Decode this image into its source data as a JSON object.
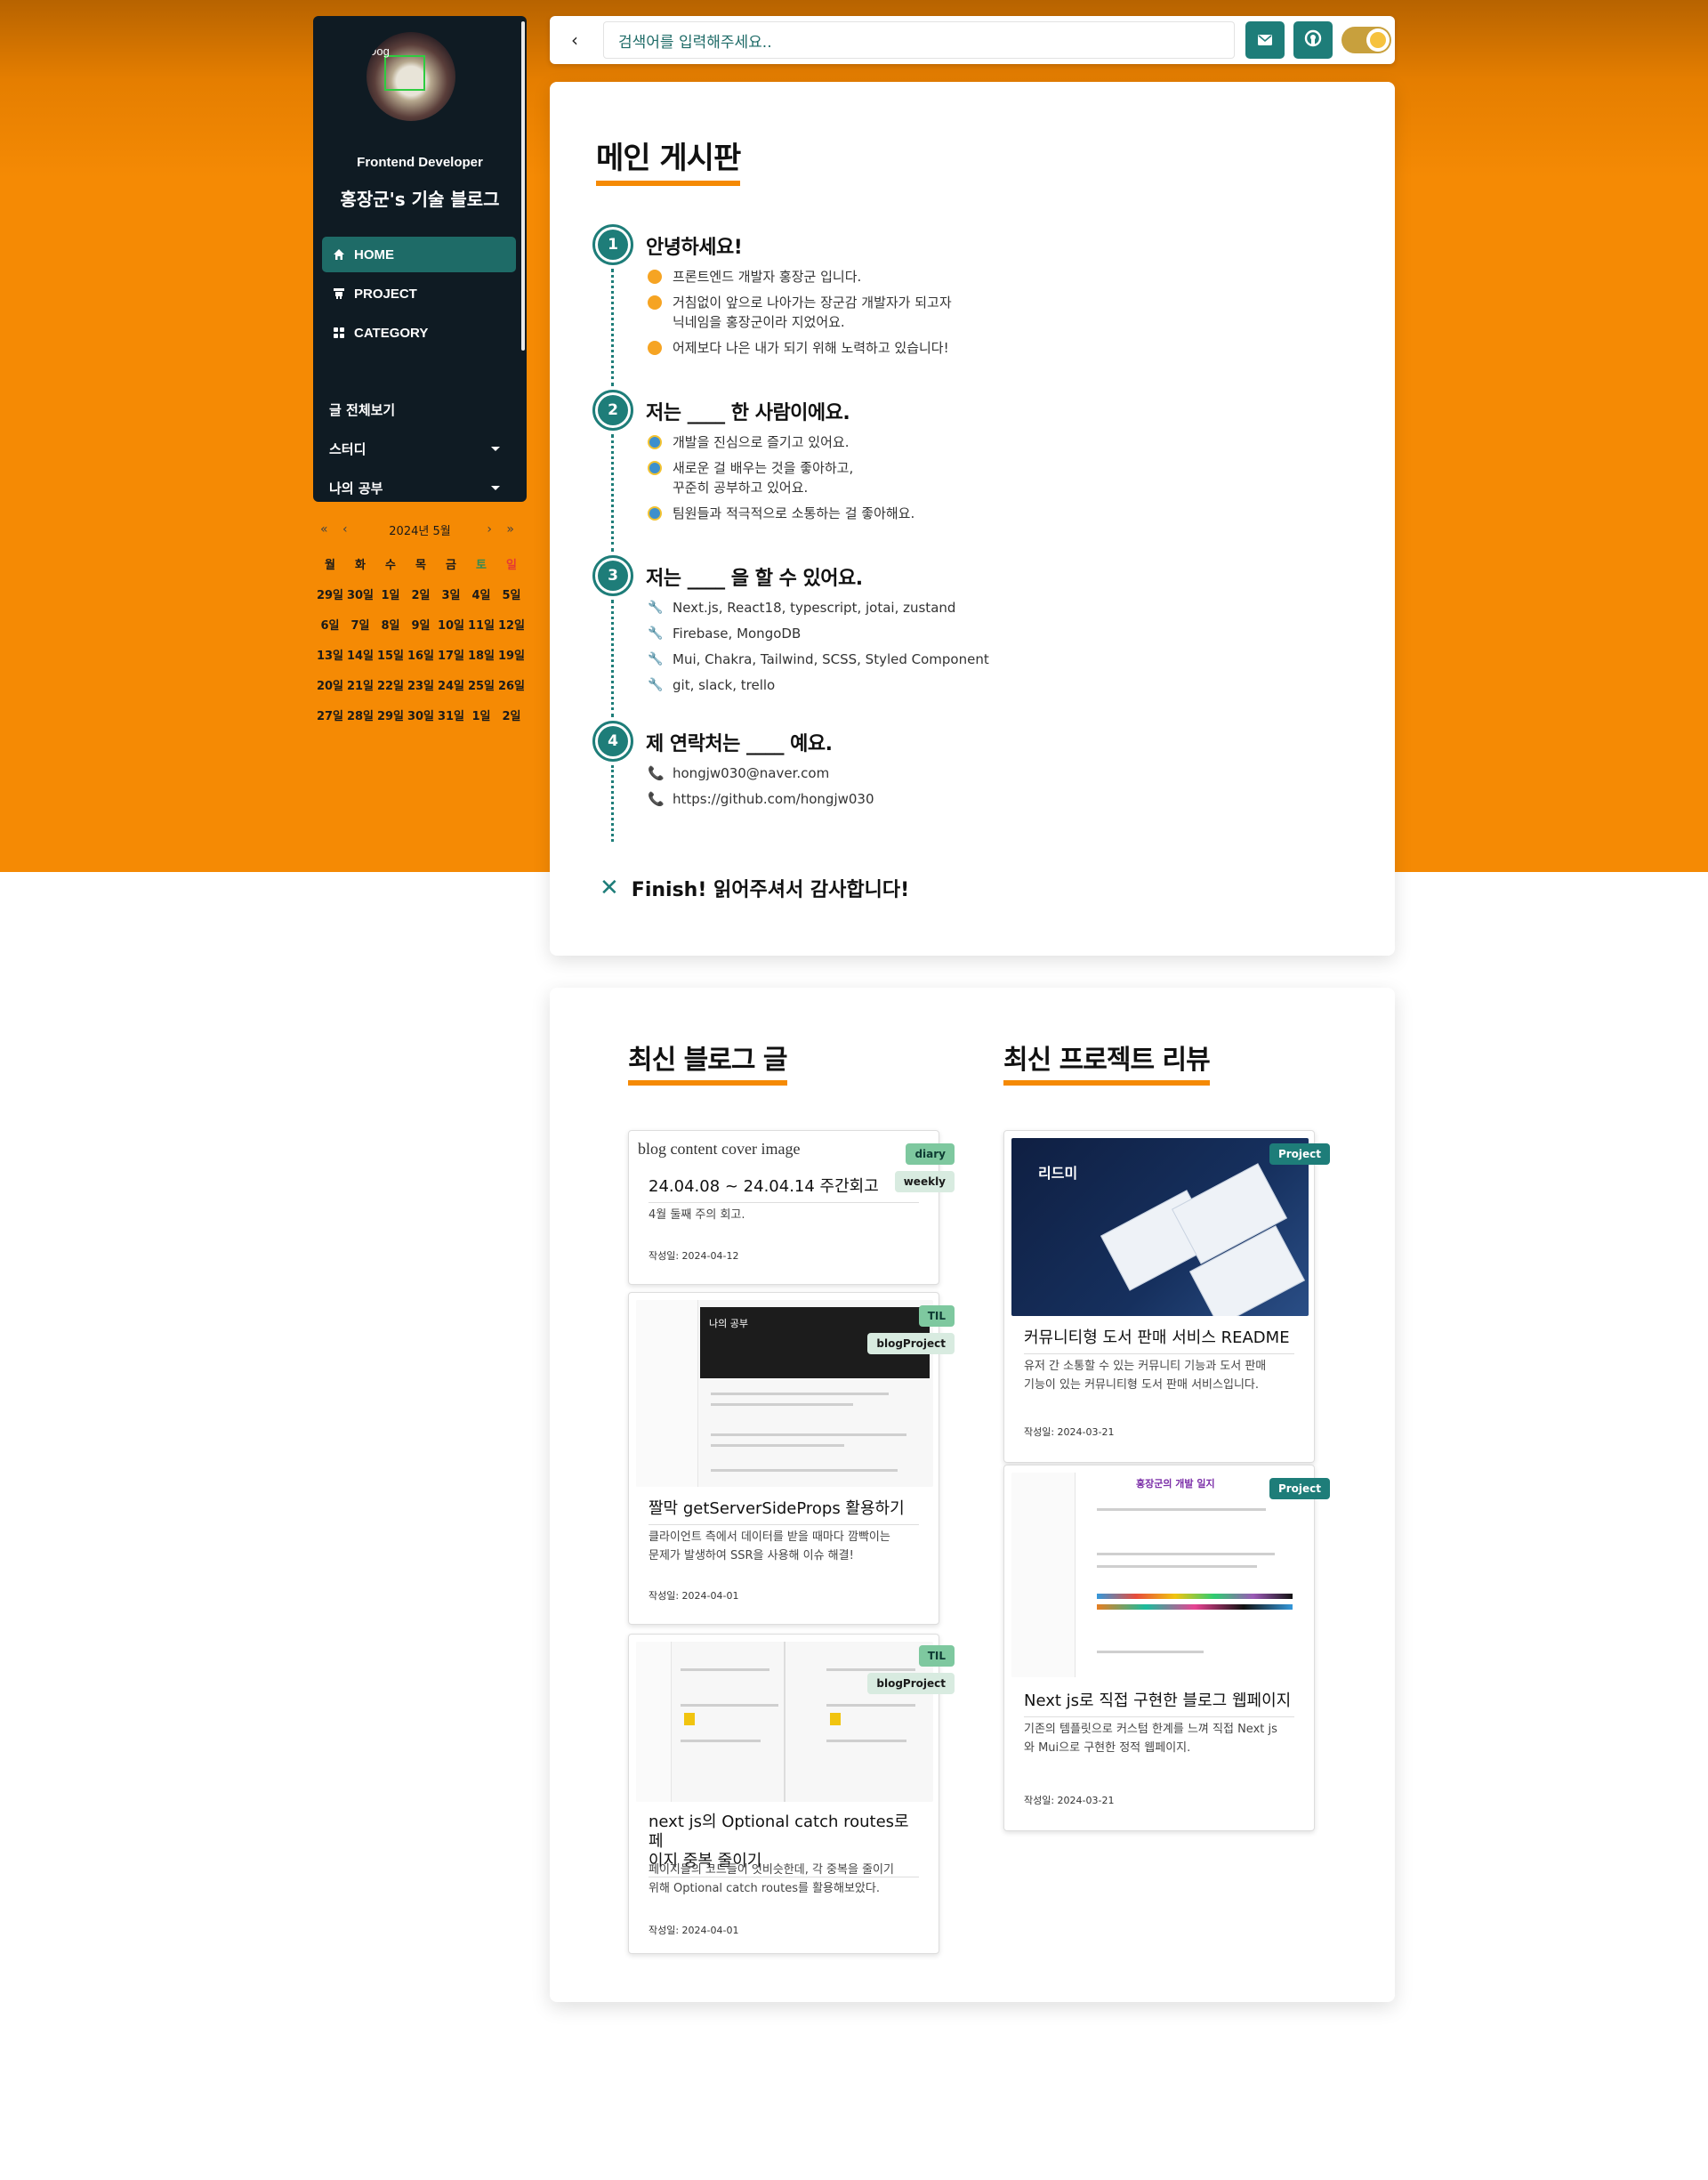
{
  "sidebar": {
    "avatar_label": "Dog",
    "role": "Frontend Developer",
    "title": "홍장군's 기술 블로그",
    "nav": [
      {
        "label": "HOME",
        "icon": "home-icon",
        "active": true
      },
      {
        "label": "PROJECT",
        "icon": "project-icon",
        "active": false
      },
      {
        "label": "CATEGORY",
        "icon": "grid-icon",
        "active": false
      }
    ],
    "categories": [
      {
        "label": "글 전체보기",
        "has_caret": false
      },
      {
        "label": "스터디",
        "has_caret": true
      },
      {
        "label": "나의 공부",
        "has_caret": true
      }
    ]
  },
  "calendar": {
    "prev": "« ‹",
    "month": "2024년 5월",
    "next": "› »",
    "weekdays": [
      "월",
      "화",
      "수",
      "목",
      "금",
      "토",
      "일"
    ],
    "weeks": [
      [
        "29일",
        "30일",
        "1일",
        "2일",
        "3일",
        "4일",
        "5일"
      ],
      [
        "6일",
        "7일",
        "8일",
        "9일",
        "10일",
        "11일",
        "12일"
      ],
      [
        "13일",
        "14일",
        "15일",
        "16일",
        "17일",
        "18일",
        "19일"
      ],
      [
        "20일",
        "21일",
        "22일",
        "23일",
        "24일",
        "25일",
        "26일"
      ],
      [
        "27일",
        "28일",
        "29일",
        "30일",
        "31일",
        "1일",
        "2일"
      ]
    ]
  },
  "topbar": {
    "back": "‹",
    "search_placeholder": "검색어를 입력해주세요..",
    "mail_icon": "mail-icon",
    "github_icon": "github-icon",
    "theme_toggle": "theme-toggle"
  },
  "board": {
    "title": "메인 게시판",
    "steps": [
      {
        "num": "1",
        "title": "안녕하세요!",
        "bullet": "emoji",
        "items": [
          "프론트엔드 개발자 홍장군 입니다.",
          "거침없이 앞으로 나아가는 장군감 개발자가 되고자\n닉네임을 홍장군이라 지었어요.",
          "어제보다 나은 내가 되기 위해 노력하고 있습니다!"
        ]
      },
      {
        "num": "2",
        "title": "저는 ____ 한 사람이에요.",
        "bullet": "shield",
        "items": [
          "개발을 진심으로 즐기고 있어요.",
          "새로운 걸 배우는 것을 좋아하고,\n꾸준히 공부하고 있어요.",
          "팀원들과 적극적으로 소통하는 걸 좋아해요."
        ]
      },
      {
        "num": "3",
        "title": "저는 ____ 을 할 수 있어요.",
        "bullet": "tool",
        "items": [
          "Next.js, React18, typescript, jotai, zustand",
          "Firebase, MongoDB",
          "Mui, Chakra, Tailwind, SCSS, Styled Component",
          "git, slack, trello"
        ]
      },
      {
        "num": "4",
        "title": "제 연락처는 ____ 예요.",
        "bullet": "phone",
        "items": [
          "hongjw030@naver.com",
          "https://github.com/hongjw030"
        ]
      }
    ],
    "finish": "Finish! 읽어주셔서 감사합니다!"
  },
  "latest": {
    "blog_title": "최신 블로그 글",
    "project_title": "최신 프로젝트 리뷰",
    "blog_cards": [
      {
        "image_alt": "blog content cover image",
        "title": "24.04.08 ~ 24.04.14 주간회고",
        "desc": "4월 둘째 주의 회고.",
        "date": "작성일: 2024-04-12",
        "tags": [
          "diary",
          "weekly"
        ]
      },
      {
        "title": "짤막 getServerSideProps 활용하기",
        "desc": "클라이언트 측에서 데이터를 받을 때마다 깜빡이는\n문제가 발생하여 SSR을 사용해 이슈 해결!",
        "date": "작성일: 2024-04-01",
        "tags": [
          "TIL",
          "blogProject"
        ],
        "shot_text": "나의 공부"
      },
      {
        "title": "next js의 Optional catch routes로 페\n이지 중복 줄이기",
        "desc": "페이지들의 코드들이 엇비슷한데, 각 중복을 줄이기\n위해 Optional catch routes를 활용해보았다.",
        "date": "작성일: 2024-04-01",
        "tags": [
          "TIL",
          "blogProject"
        ]
      }
    ],
    "project_cards": [
      {
        "title": "커뮤니티형 도서 판매 서비스 README",
        "desc": "유저 간 소통할 수 있는 커뮤니티 기능과 도서 판매\n기능이 있는 커뮤니티형 도서 판매 서비스입니다.",
        "date": "작성일: 2024-03-21",
        "tag": "Project",
        "shot_text": "리드미"
      },
      {
        "title": "Next js로 직접 구현한 블로그 웹페이지",
        "desc": "기존의 템플릿으로 커스텀 한계를 느껴 직접 Next js\n와 Mui으로 구현한 정적 웹페이지.",
        "date": "작성일: 2024-03-21",
        "tag": "Project",
        "shot_text": "홍장군의 개발 일지"
      }
    ]
  },
  "colors": {
    "orange": "#f58a04",
    "teal": "#1e7d79",
    "sidebar_bg": "#0f1b23",
    "nav_active": "#1e6b67"
  }
}
